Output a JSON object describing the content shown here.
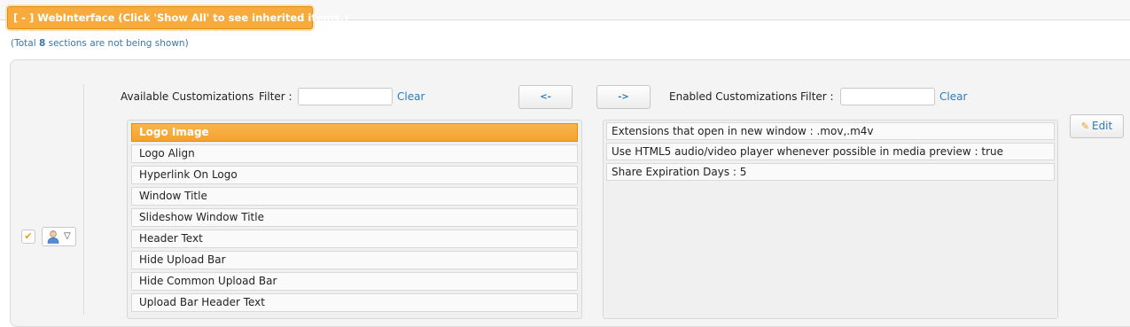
{
  "header": {
    "section_label": "[ - ] WebInterface (Click 'Show All' to see inherited items.)",
    "hidden_prefix": "(Total ",
    "hidden_count": "8",
    "hidden_suffix": " sections are not being shown)"
  },
  "available": {
    "title": "Available Customizations",
    "filter_label": "Filter :",
    "filter_value": "",
    "clear_label": "Clear",
    "items": [
      "Logo Image",
      "Logo Align",
      "Hyperlink On Logo",
      "Window Title",
      "Slideshow Window Title",
      "Header Text",
      "Hide Upload Bar",
      "Hide Common Upload Bar",
      "Upload Bar Header Text"
    ],
    "selected_index": 0
  },
  "buttons": {
    "move_left": "<-",
    "move_right": "->",
    "edit": "Edit"
  },
  "enabled": {
    "title": "Enabled Customizations",
    "filter_label": "Filter :",
    "filter_value": "",
    "clear_label": "Clear",
    "items": [
      "Extensions that open in new window : .mov,.m4v",
      "Use HTML5 audio/video player whenever possible in media preview : true",
      "Share Expiration Days : 5"
    ]
  },
  "row_controls": {
    "checkbox_checked": true,
    "checkmark_glyph": "✔",
    "user_icon": "user-icon",
    "caret_glyph": "▽"
  },
  "colors": {
    "accent_orange": "#f7ab3c",
    "link_blue": "#2e7ab8"
  }
}
